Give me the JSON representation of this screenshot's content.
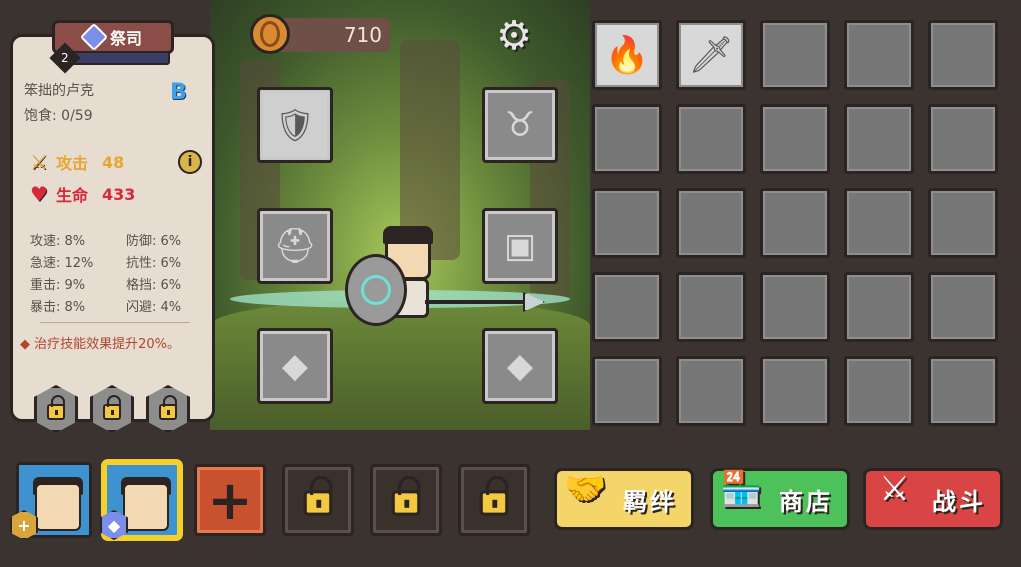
{
  "hero": {
    "class_name": "祭司",
    "level": "2",
    "level_progress": 0.06,
    "name": "笨拙的卢克",
    "rank": "B",
    "satiety_label": "饱食: 0/59",
    "attack_label": "攻击",
    "attack_value": "48",
    "hp_label": "生命",
    "hp_value": "433",
    "stats": [
      {
        "label": "攻速: 8%"
      },
      {
        "label": "防御: 6%"
      },
      {
        "label": "急速: 12%"
      },
      {
        "label": "抗性: 6%"
      },
      {
        "label": "重击: 9%"
      },
      {
        "label": "格挡: 6%"
      },
      {
        "label": "暴击: 8%"
      },
      {
        "label": "闪避: 4%"
      }
    ],
    "note": "◆ 治疗技能效果提升20%。"
  },
  "currency": {
    "coins": "710"
  },
  "icons": {
    "coin": "coin-icon",
    "settings": "gear-icon",
    "info": "info-icon",
    "lock": "lock-icon"
  },
  "colors": {
    "attack": "#e8a531",
    "hp": "#d9283a",
    "rank": "#3da0e8",
    "bond_button": "#f4d56a",
    "shop_button": "#4ec25a",
    "battle_button": "#d94545"
  },
  "equipment_slots": [
    "weapon",
    "helmet-slot",
    "horns-slot",
    "armor-slot",
    "gem-slot-1",
    "gem-slot-2"
  ],
  "inventory": {
    "items": [
      "flaming-shield",
      "sword"
    ]
  },
  "buttons": {
    "bond": "羁绊",
    "shop": "商店",
    "battle": "战斗"
  }
}
